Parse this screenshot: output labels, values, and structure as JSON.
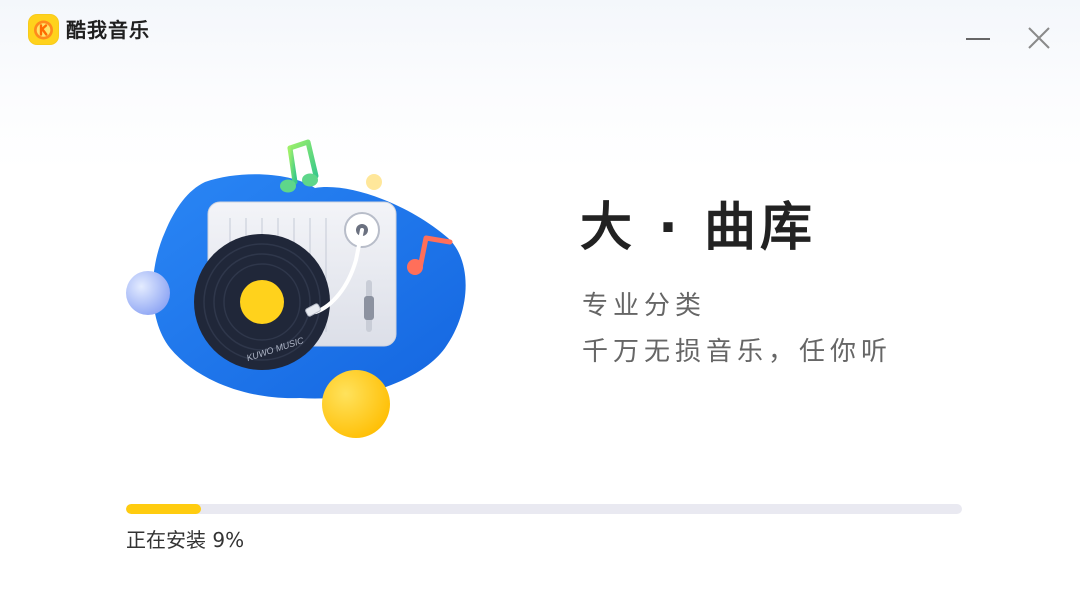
{
  "app": {
    "title": "酷我音乐",
    "logo_icon": "kuwo-logo-icon",
    "logo_color": "#ffd21c"
  },
  "window_controls": {
    "minimize_icon": "minimize-icon",
    "close_icon": "close-icon"
  },
  "illustration": {
    "vinyl_text": "KUWO MUSIC",
    "icon": "record-player-icon",
    "blob_color": "#1f7cf0",
    "accent_yellow": "#ffc914"
  },
  "slogan": {
    "headline": "大 · 曲库",
    "line1": "专业分类",
    "line2": "千万无损音乐，任你听"
  },
  "install": {
    "progress_percent": 9,
    "status_text": "正在安装 9%",
    "fill_color": "#ffcc0f",
    "track_color": "#e9e9f1"
  }
}
